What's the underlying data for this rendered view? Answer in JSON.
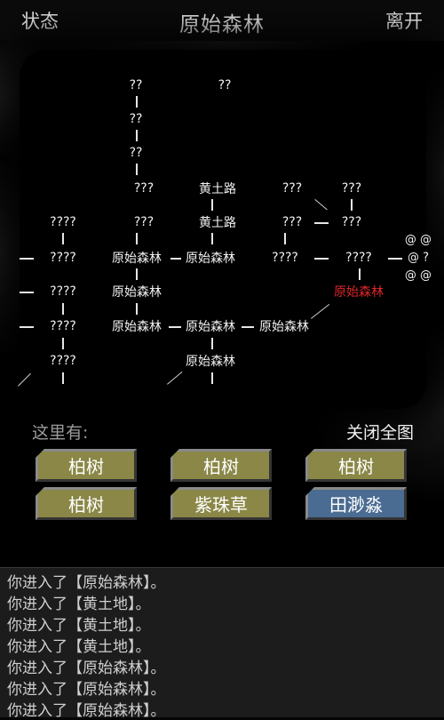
{
  "header": {
    "left_button": "状态",
    "title": "原始森林",
    "right_button": "离开"
  },
  "map": {
    "nodes": [
      {
        "id": "n1",
        "label": "??"
      },
      {
        "id": "n2",
        "label": "??"
      },
      {
        "id": "n3",
        "label": "??"
      },
      {
        "id": "n4",
        "label": "??"
      },
      {
        "id": "n5",
        "label": "???"
      },
      {
        "id": "n6",
        "label": "黄土路"
      },
      {
        "id": "n7",
        "label": "???"
      },
      {
        "id": "n8",
        "label": "???"
      },
      {
        "id": "n9",
        "label": "????"
      },
      {
        "id": "n10",
        "label": "???"
      },
      {
        "id": "n11",
        "label": "黄土路"
      },
      {
        "id": "n12",
        "label": "???"
      },
      {
        "id": "n13",
        "label": "???"
      },
      {
        "id": "n14",
        "label": "????"
      },
      {
        "id": "n15",
        "label": "原始森林"
      },
      {
        "id": "n16",
        "label": "原始森林"
      },
      {
        "id": "n17",
        "label": "????"
      },
      {
        "id": "n18",
        "label": "????"
      },
      {
        "id": "n19",
        "label": "????"
      },
      {
        "id": "n20",
        "label": "原始森林"
      },
      {
        "id": "n21",
        "label": "原始森林"
      },
      {
        "id": "n22",
        "label": "????"
      },
      {
        "id": "n23",
        "label": "原始森林"
      },
      {
        "id": "n24",
        "label": "原始森林"
      },
      {
        "id": "n25",
        "label": "原始森林"
      },
      {
        "id": "n26",
        "label": "????"
      },
      {
        "id": "n27",
        "label": "原始森林"
      }
    ],
    "edge_marks": [
      "@ @",
      "@ ?",
      "@ @"
    ],
    "current_color": "#e0262a"
  },
  "panel": {
    "here_label": "这里有:",
    "close_map": "关闭全图",
    "items": [
      "柏树",
      "柏树",
      "柏树",
      "柏树",
      "紫珠草",
      "田渺淼"
    ],
    "item_color": "#8a8747",
    "npc_color": "#4a6b92"
  },
  "log": [
    "你进入了【原始森林】。",
    "你进入了【黄土地】。",
    "你进入了【黄土地】。",
    "你进入了【黄土地】。",
    "你进入了【原始森林】。",
    "你进入了【原始森林】。",
    "你进入了【原始森林】。"
  ]
}
